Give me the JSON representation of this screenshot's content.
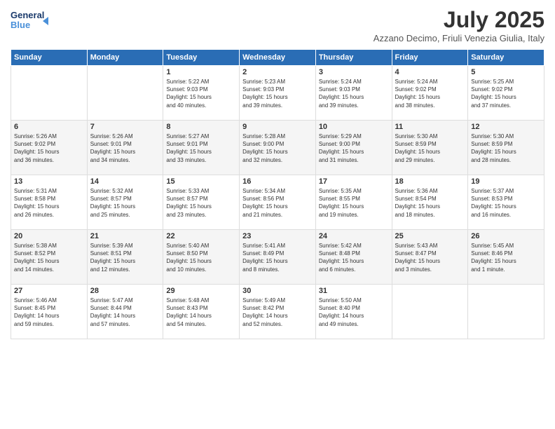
{
  "logo": {
    "line1": "General",
    "line2": "Blue"
  },
  "title": "July 2025",
  "subtitle": "Azzano Decimo, Friuli Venezia Giulia, Italy",
  "weekdays": [
    "Sunday",
    "Monday",
    "Tuesday",
    "Wednesday",
    "Thursday",
    "Friday",
    "Saturday"
  ],
  "weeks": [
    [
      {
        "day": "",
        "info": ""
      },
      {
        "day": "",
        "info": ""
      },
      {
        "day": "1",
        "info": "Sunrise: 5:22 AM\nSunset: 9:03 PM\nDaylight: 15 hours\nand 40 minutes."
      },
      {
        "day": "2",
        "info": "Sunrise: 5:23 AM\nSunset: 9:03 PM\nDaylight: 15 hours\nand 39 minutes."
      },
      {
        "day": "3",
        "info": "Sunrise: 5:24 AM\nSunset: 9:03 PM\nDaylight: 15 hours\nand 39 minutes."
      },
      {
        "day": "4",
        "info": "Sunrise: 5:24 AM\nSunset: 9:02 PM\nDaylight: 15 hours\nand 38 minutes."
      },
      {
        "day": "5",
        "info": "Sunrise: 5:25 AM\nSunset: 9:02 PM\nDaylight: 15 hours\nand 37 minutes."
      }
    ],
    [
      {
        "day": "6",
        "info": "Sunrise: 5:26 AM\nSunset: 9:02 PM\nDaylight: 15 hours\nand 36 minutes."
      },
      {
        "day": "7",
        "info": "Sunrise: 5:26 AM\nSunset: 9:01 PM\nDaylight: 15 hours\nand 34 minutes."
      },
      {
        "day": "8",
        "info": "Sunrise: 5:27 AM\nSunset: 9:01 PM\nDaylight: 15 hours\nand 33 minutes."
      },
      {
        "day": "9",
        "info": "Sunrise: 5:28 AM\nSunset: 9:00 PM\nDaylight: 15 hours\nand 32 minutes."
      },
      {
        "day": "10",
        "info": "Sunrise: 5:29 AM\nSunset: 9:00 PM\nDaylight: 15 hours\nand 31 minutes."
      },
      {
        "day": "11",
        "info": "Sunrise: 5:30 AM\nSunset: 8:59 PM\nDaylight: 15 hours\nand 29 minutes."
      },
      {
        "day": "12",
        "info": "Sunrise: 5:30 AM\nSunset: 8:59 PM\nDaylight: 15 hours\nand 28 minutes."
      }
    ],
    [
      {
        "day": "13",
        "info": "Sunrise: 5:31 AM\nSunset: 8:58 PM\nDaylight: 15 hours\nand 26 minutes."
      },
      {
        "day": "14",
        "info": "Sunrise: 5:32 AM\nSunset: 8:57 PM\nDaylight: 15 hours\nand 25 minutes."
      },
      {
        "day": "15",
        "info": "Sunrise: 5:33 AM\nSunset: 8:57 PM\nDaylight: 15 hours\nand 23 minutes."
      },
      {
        "day": "16",
        "info": "Sunrise: 5:34 AM\nSunset: 8:56 PM\nDaylight: 15 hours\nand 21 minutes."
      },
      {
        "day": "17",
        "info": "Sunrise: 5:35 AM\nSunset: 8:55 PM\nDaylight: 15 hours\nand 19 minutes."
      },
      {
        "day": "18",
        "info": "Sunrise: 5:36 AM\nSunset: 8:54 PM\nDaylight: 15 hours\nand 18 minutes."
      },
      {
        "day": "19",
        "info": "Sunrise: 5:37 AM\nSunset: 8:53 PM\nDaylight: 15 hours\nand 16 minutes."
      }
    ],
    [
      {
        "day": "20",
        "info": "Sunrise: 5:38 AM\nSunset: 8:52 PM\nDaylight: 15 hours\nand 14 minutes."
      },
      {
        "day": "21",
        "info": "Sunrise: 5:39 AM\nSunset: 8:51 PM\nDaylight: 15 hours\nand 12 minutes."
      },
      {
        "day": "22",
        "info": "Sunrise: 5:40 AM\nSunset: 8:50 PM\nDaylight: 15 hours\nand 10 minutes."
      },
      {
        "day": "23",
        "info": "Sunrise: 5:41 AM\nSunset: 8:49 PM\nDaylight: 15 hours\nand 8 minutes."
      },
      {
        "day": "24",
        "info": "Sunrise: 5:42 AM\nSunset: 8:48 PM\nDaylight: 15 hours\nand 6 minutes."
      },
      {
        "day": "25",
        "info": "Sunrise: 5:43 AM\nSunset: 8:47 PM\nDaylight: 15 hours\nand 3 minutes."
      },
      {
        "day": "26",
        "info": "Sunrise: 5:45 AM\nSunset: 8:46 PM\nDaylight: 15 hours\nand 1 minute."
      }
    ],
    [
      {
        "day": "27",
        "info": "Sunrise: 5:46 AM\nSunset: 8:45 PM\nDaylight: 14 hours\nand 59 minutes."
      },
      {
        "day": "28",
        "info": "Sunrise: 5:47 AM\nSunset: 8:44 PM\nDaylight: 14 hours\nand 57 minutes."
      },
      {
        "day": "29",
        "info": "Sunrise: 5:48 AM\nSunset: 8:43 PM\nDaylight: 14 hours\nand 54 minutes."
      },
      {
        "day": "30",
        "info": "Sunrise: 5:49 AM\nSunset: 8:42 PM\nDaylight: 14 hours\nand 52 minutes."
      },
      {
        "day": "31",
        "info": "Sunrise: 5:50 AM\nSunset: 8:40 PM\nDaylight: 14 hours\nand 49 minutes."
      },
      {
        "day": "",
        "info": ""
      },
      {
        "day": "",
        "info": ""
      }
    ]
  ]
}
